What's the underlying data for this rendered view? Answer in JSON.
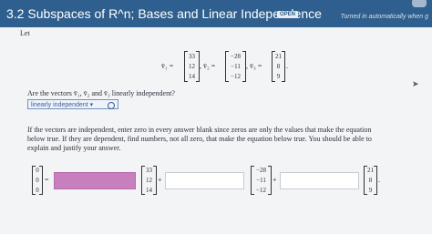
{
  "header": {
    "title": "3.2 Subspaces of R^n; Bases and Linear Independence",
    "badge": "OPEN",
    "status": "Turned in automatically when g"
  },
  "problem": {
    "let": "Let",
    "v1_label": "v̄₁ =",
    "v2_label": ", v̄₂ =",
    "v3_label": ", v̄₃ =",
    "end_period": ".",
    "v1": [
      "33",
      "12",
      "14"
    ],
    "v2": [
      "−28",
      "−11",
      "−12"
    ],
    "v3": [
      "21",
      "8",
      "9"
    ],
    "question": "Are the vectors v̄₁, v̄₂ and v̄₃ linearly independent?",
    "dropdown_value": "linearly independent",
    "instruction_1": "If the vectors are independent, enter zero in every answer blank since zeros are only the values that make the equation",
    "instruction_2": "below true. If they are dependent, find numbers, not all zero, that make the equation below true. You should be able to",
    "instruction_3": "explain and justify your answer.",
    "zero_vector": [
      "0",
      "0",
      "0"
    ],
    "equals": "=",
    "plus1": "+",
    "plus2": "+",
    "final_period": "."
  },
  "colors": {
    "header_bg": "#2f5f8e",
    "highlight_field": "#c77fbd"
  }
}
